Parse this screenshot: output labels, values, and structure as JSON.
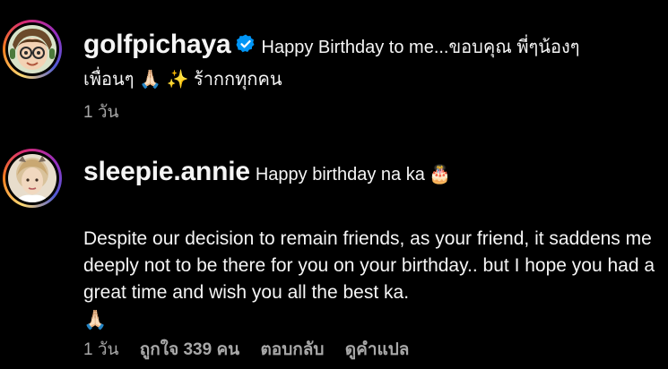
{
  "comments": [
    {
      "username": "golfpichaya",
      "verified": true,
      "text_line1": "Happy Birthday to me...ขอบคุณ พี่ๆน้องๆ",
      "text_line2_pre": "เพื่อนๆ",
      "text_line2_post": "ร้ากกทุกคน",
      "emoji_1": "🙏🏻",
      "emoji_2": "✨",
      "time": "1 วัน"
    },
    {
      "username": "sleepie.annie",
      "verified": false,
      "text_line1": "Happy birthday na ka",
      "emoji_1": "🎂",
      "body": "Despite our decision to remain friends, as your friend, it saddens me deeply not to be there for you on your birthday.. but I hope you had a great time and wish you all the best ka.",
      "emoji_end": "🙏🏻",
      "time": "1 วัน",
      "likes": "ถูกใจ 339 คน",
      "reply": "ตอบกลับ",
      "translate": "ดูคำแปล"
    }
  ],
  "colors": {
    "background": "#000000",
    "text": "#f5f5f5",
    "meta": "#a8a8a8",
    "verified": "#0095f6"
  },
  "icons": {
    "verified": "verified-badge-icon",
    "pray": "folded-hands-icon",
    "sparkles": "sparkles-icon",
    "cake": "birthday-cake-icon"
  }
}
